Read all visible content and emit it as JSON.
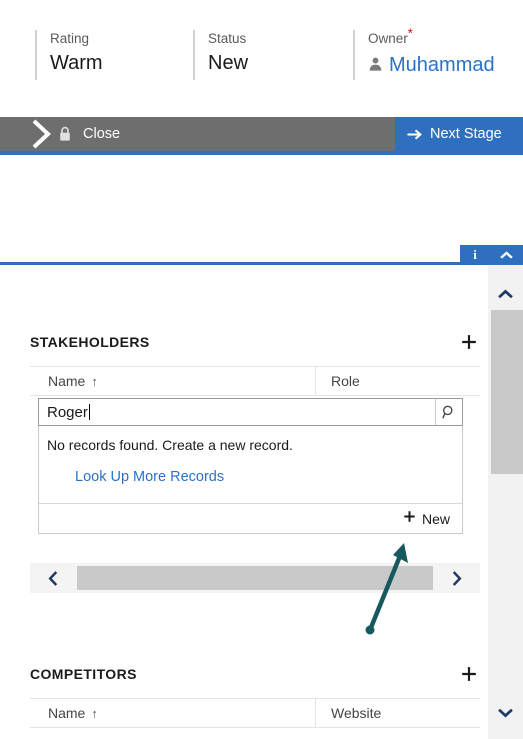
{
  "header": {
    "fields": [
      {
        "label": "Rating",
        "value": "Warm",
        "required": false,
        "type": "text"
      },
      {
        "label": "Status",
        "value": "New",
        "required": false,
        "type": "text"
      },
      {
        "label": "Owner",
        "value": "Muhammad",
        "required": true,
        "type": "lookup",
        "icon": "person-icon"
      }
    ],
    "required_marker": "*"
  },
  "stage_bar": {
    "stage_label": "Close",
    "lock_icon": "lock-icon",
    "chevron_icon": "stage-chevron-icon",
    "next_stage_label": "Next Stage",
    "next_stage_icon": "arrow-right-icon",
    "bar_color": "#6e6e6e",
    "next_stage_color": "#2f6fbf"
  },
  "notification_bar": {
    "info_label": "i",
    "info_icon": "info-icon",
    "collapse_icon": "chevron-up-icon",
    "color": "#2f6fbf"
  },
  "sections": [
    {
      "title": "STAKEHOLDERS",
      "add_icon": "plus-icon",
      "columns": [
        "Name",
        "Role"
      ],
      "sort_column": "Name",
      "sort_direction": "ascending",
      "sort_glyph": "↑",
      "rows": [],
      "lookup": {
        "value": "Roger",
        "placeholder": "",
        "search_icon": "search-icon",
        "dropdown": {
          "message": "No records found. Create a new record.",
          "link_label": "Look Up More Records",
          "new_label": "New",
          "new_icon": "plus-icon"
        }
      },
      "pager": {
        "prev_icon": "chevron-left-icon",
        "next_icon": "chevron-right-icon"
      }
    },
    {
      "title": "COMPETITORS",
      "add_icon": "plus-icon",
      "columns": [
        "Name",
        "Website"
      ],
      "sort_column": "Name",
      "sort_direction": "ascending",
      "sort_glyph": "↑",
      "rows": []
    }
  ],
  "scrollbar": {
    "up_icon": "chevron-up-icon",
    "down_icon": "chevron-down-icon",
    "thumb_color": "#c9c9c9"
  },
  "annotation": {
    "type": "arrow",
    "color": "#17595e",
    "points_to": "New"
  }
}
